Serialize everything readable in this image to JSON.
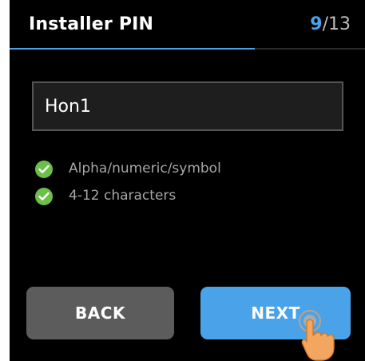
{
  "header": {
    "title": "Installer PIN",
    "step_current": "9",
    "step_total": "/13",
    "progress_fraction": 0.69
  },
  "pin_field": {
    "value": "Hon1"
  },
  "requirements": [
    {
      "label": "Alpha/numeric/symbol",
      "met": true,
      "icon": "check-circle-icon"
    },
    {
      "label": "4-12 characters",
      "met": true,
      "icon": "check-circle-icon"
    }
  ],
  "buttons": {
    "back_label": "BACK",
    "next_label": "NEXT"
  },
  "colors": {
    "accent": "#4aa3e8",
    "check": "#6cc04a",
    "background": "#000000",
    "back_button": "#5c5c5c"
  }
}
